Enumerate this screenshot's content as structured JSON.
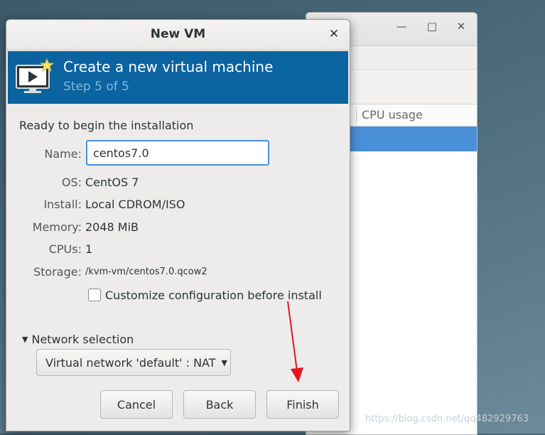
{
  "background_window": {
    "minimize_icon": "—",
    "maximize_icon": "□",
    "close_icon": "✕",
    "column_header": "CPU usage"
  },
  "dialog": {
    "title": "New VM",
    "close_icon": "✕",
    "banner": {
      "title": "Create a new virtual machine",
      "step": "Step 5 of 5"
    },
    "ready_text": "Ready to begin the installation",
    "fields": {
      "name_label": "Name:",
      "name_value": "centos7.0",
      "os_label": "OS:",
      "os_value": "CentOS 7",
      "install_label": "Install:",
      "install_value": "Local CDROM/ISO",
      "memory_label": "Memory:",
      "memory_value": "2048 MiB",
      "cpus_label": "CPUs:",
      "cpus_value": "1",
      "storage_label": "Storage:",
      "storage_value": "/kvm-vm/centos7.0.qcow2"
    },
    "customize_label": "Customize configuration before install",
    "customize_checked": false,
    "network_section_label": "Network selection",
    "network_value": "Virtual network 'default' : NAT",
    "buttons": {
      "cancel": "Cancel",
      "back": "Back",
      "finish": "Finish"
    }
  },
  "watermark": "https://blog.csdn.net/qq482929763",
  "colors": {
    "banner": "#0b63a0",
    "step_text": "#82b8e0",
    "selection": "#4a90d9",
    "annotation_arrow": "#e8141b"
  }
}
